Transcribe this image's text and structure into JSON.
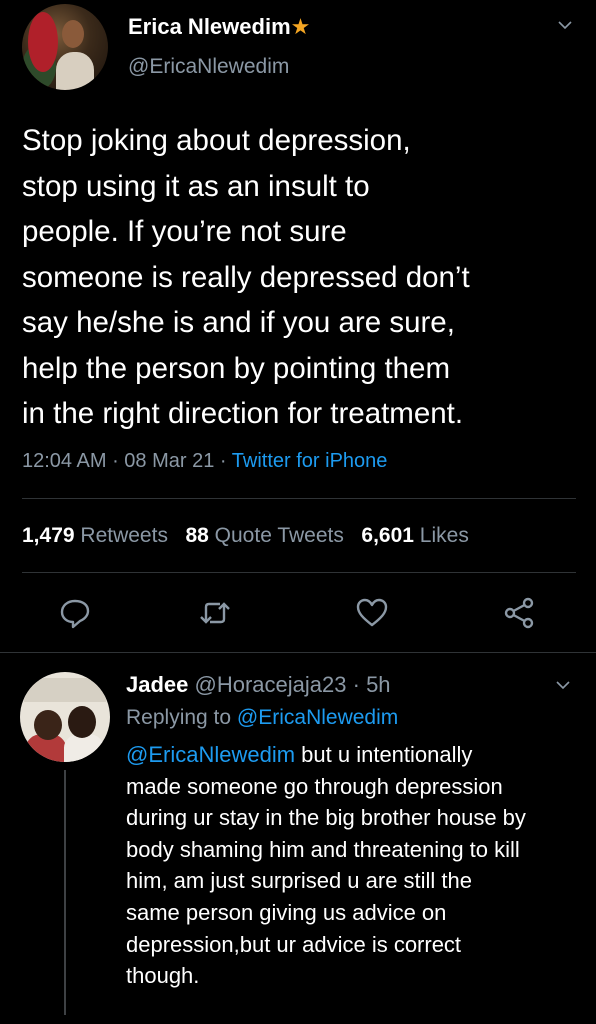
{
  "tweet": {
    "author": {
      "name": "Erica Nlewedim",
      "badge": "★",
      "handle": "@EricaNlewedim"
    },
    "text": "Stop joking about depression,\nstop using it as an insult to\npeople. If you’re not sure\nsomeone is really depressed don’t\nsay he/she is and if you are sure,\nhelp the person by pointing them\nin the right direction for treatment.",
    "time": "12:04 AM",
    "date": "08 Mar 21",
    "source": "Twitter for iPhone",
    "separator": " · ",
    "stats": {
      "retweets_count": "1,479",
      "retweets_label": "Retweets",
      "quotes_count": "88",
      "quotes_label": "Quote Tweets",
      "likes_count": "6,601",
      "likes_label": "Likes"
    },
    "actions": [
      "reply-icon",
      "retweet-icon",
      "like-icon",
      "share-icon"
    ]
  },
  "reply": {
    "name": "Jadee",
    "handle": "@Horacejaja23",
    "time_ago": "5h",
    "replying_label": "Replying to",
    "replying_to": "@EricaNlewedim",
    "mention": "@EricaNlewedim",
    "text": " but u intentionally\nmade someone go through depression\nduring ur stay in the big brother house by\nbody shaming him and threatening to kill\nhim, am just surprised u are still the\nsame person giving us advice on\ndepression,but ur advice is correct\nthough."
  },
  "colors": {
    "background": "#000000",
    "text": "#ffffff",
    "secondary": "#8b98a5",
    "link": "#1d9bf0",
    "badge": "#f5a623"
  }
}
